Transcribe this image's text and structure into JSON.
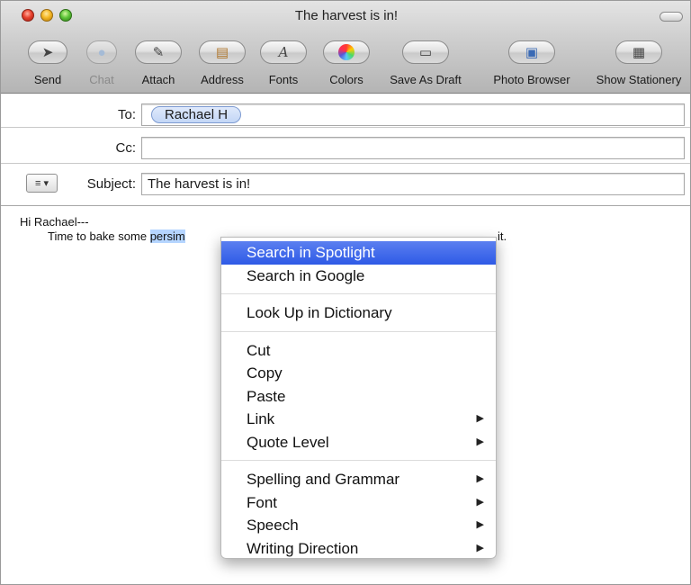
{
  "window": {
    "title": "The harvest is in!"
  },
  "toolbar": [
    {
      "label": "Send",
      "icon": "paper-plane",
      "enabled": true
    },
    {
      "label": "Chat",
      "icon": "chat-bubble",
      "enabled": false
    },
    {
      "label": "Attach",
      "icon": "paperclip",
      "enabled": true
    },
    {
      "label": "Address",
      "icon": "address-book",
      "enabled": true
    },
    {
      "label": "Fonts",
      "icon": "font-A",
      "enabled": true
    },
    {
      "label": "Colors",
      "icon": "color-wheel",
      "enabled": true
    },
    {
      "label": "Save As Draft",
      "icon": "draft-page",
      "enabled": true
    },
    {
      "label": "Photo Browser",
      "icon": "photo",
      "enabled": true
    },
    {
      "label": "Show Stationery",
      "icon": "stationery",
      "enabled": true
    }
  ],
  "fields": {
    "to_label": "To:",
    "to_recipient": "Rachael H",
    "cc_label": "Cc:",
    "cc_value": "",
    "subject_label": "Subject:",
    "subject_value": "The harvest is in!",
    "account_button": "≡ ▾"
  },
  "body": {
    "line1": "Hi Rachael---",
    "line2_prefix": "Time to bake some ",
    "line2_selected": "persim",
    "line2_tail": "it."
  },
  "context_menu": {
    "groups": [
      [
        {
          "label": "Search in Spotlight",
          "selected": true,
          "submenu": false
        },
        {
          "label": "Search in Google",
          "selected": false,
          "submenu": false
        }
      ],
      [
        {
          "label": "Look Up in Dictionary",
          "selected": false,
          "submenu": false
        }
      ],
      [
        {
          "label": "Cut",
          "selected": false,
          "submenu": false
        },
        {
          "label": "Copy",
          "selected": false,
          "submenu": false
        },
        {
          "label": "Paste",
          "selected": false,
          "submenu": false
        },
        {
          "label": "Link",
          "selected": false,
          "submenu": true
        },
        {
          "label": "Quote Level",
          "selected": false,
          "submenu": true
        }
      ],
      [
        {
          "label": "Spelling and Grammar",
          "selected": false,
          "submenu": true
        },
        {
          "label": "Font",
          "selected": false,
          "submenu": true
        },
        {
          "label": "Speech",
          "selected": false,
          "submenu": true
        },
        {
          "label": "Writing Direction",
          "selected": false,
          "submenu": true
        }
      ]
    ],
    "submenu_arrow": "▶"
  },
  "colors": {
    "selection": "#b5d5ff",
    "menu_highlight": "#2e5ae6",
    "token_fill": "#c3d6f6"
  }
}
